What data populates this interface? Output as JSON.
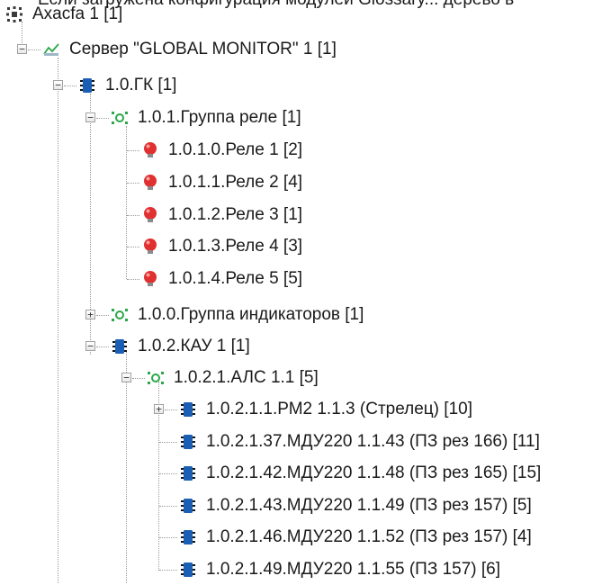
{
  "cut_text": "Если загружена конфигурация модулей Glossary... дерево в",
  "tree": {
    "root": {
      "label": "Axacfa 1 [1]",
      "icon": "network-grid-icon"
    },
    "server": {
      "label": "Сервер \"GLOBAL MONITOR\" 1 [1]",
      "icon": "server-check-icon",
      "expander": "−"
    },
    "gk": {
      "label": "1.0.ГК [1]",
      "icon": "module-chip-icon",
      "expander": "−"
    },
    "relay_group": {
      "label": "1.0.1.Группа реле [1]",
      "icon": "group-icon",
      "expander": "−"
    },
    "relays": [
      {
        "label": "1.0.1.0.Реле 1 [2]",
        "icon": "relay-bulb-icon"
      },
      {
        "label": "1.0.1.1.Реле 2 [4]",
        "icon": "relay-bulb-icon"
      },
      {
        "label": "1.0.1.2.Реле 3 [1]",
        "icon": "relay-bulb-icon"
      },
      {
        "label": "1.0.1.3.Реле 4 [3]",
        "icon": "relay-bulb-icon"
      },
      {
        "label": "1.0.1.4.Реле 5 [5]",
        "icon": "relay-bulb-icon"
      }
    ],
    "indicator_group": {
      "label": "1.0.0.Группа индикаторов [1]",
      "icon": "group-icon",
      "expander": "+"
    },
    "kau": {
      "label": "1.0.2.КАУ 1 [1]",
      "icon": "module-chip-icon",
      "expander": "−"
    },
    "als": {
      "label": "1.0.2.1.АЛС 1.1 [5]",
      "icon": "group-icon",
      "expander": "−"
    },
    "devices": [
      {
        "label": "1.0.2.1.1.РМ2 1.1.3 (Стрелец) [10]",
        "icon": "module-chip-icon",
        "expander": "+"
      },
      {
        "label": "1.0.2.1.37.МДУ220 1.1.43 (ПЗ рез 166) [11]",
        "icon": "module-chip-icon"
      },
      {
        "label": "1.0.2.1.42.МДУ220 1.1.48 (ПЗ рез 165) [15]",
        "icon": "module-chip-icon"
      },
      {
        "label": "1.0.2.1.43.МДУ220 1.1.49 (ПЗ рез 157) [5]",
        "icon": "module-chip-icon"
      },
      {
        "label": "1.0.2.1.46.МДУ220 1.1.52 (ПЗ рез 157) [4]",
        "icon": "module-chip-icon"
      },
      {
        "label": "1.0.2.1.49.МДУ220 1.1.55 (ПЗ 157) [6]",
        "icon": "module-chip-icon"
      }
    ]
  },
  "colors": {
    "chip": "#1a5fb4",
    "relay": "#e03030",
    "group": "#2aa84a",
    "connector": "#9a9a9a"
  }
}
